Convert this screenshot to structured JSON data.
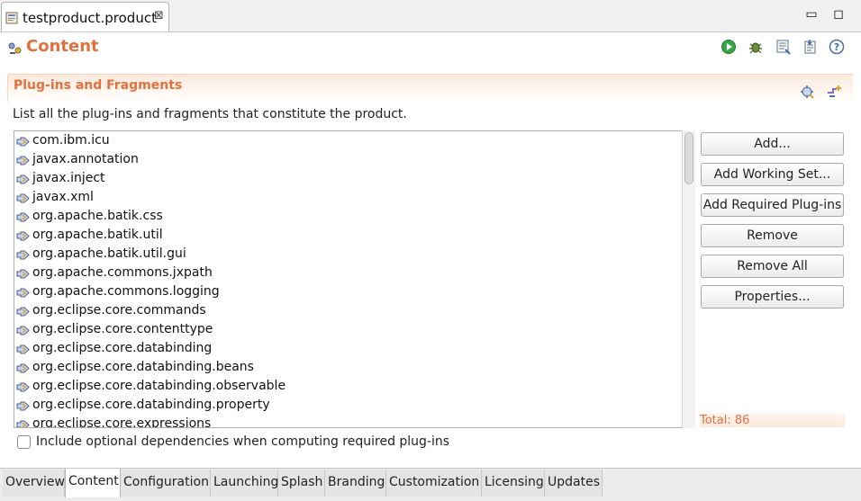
{
  "editor": {
    "tab_title": "testproduct.product",
    "close_glyph": "⊠",
    "minimize_glyph": "▭",
    "maximize_glyph": "◻"
  },
  "header": {
    "title": "Content"
  },
  "section": {
    "title": "Plug-ins and Fragments",
    "description": "List all the plug-ins and fragments that constitute the product."
  },
  "plugins": [
    "com.ibm.icu",
    "javax.annotation",
    "javax.inject",
    "javax.xml",
    "org.apache.batik.css",
    "org.apache.batik.util",
    "org.apache.batik.util.gui",
    "org.apache.commons.jxpath",
    "org.apache.commons.logging",
    "org.eclipse.core.commands",
    "org.eclipse.core.contenttype",
    "org.eclipse.core.databinding",
    "org.eclipse.core.databinding.beans",
    "org.eclipse.core.databinding.observable",
    "org.eclipse.core.databinding.property",
    "org.eclipse.core.expressions"
  ],
  "buttons": {
    "add": "Add...",
    "add_working_set": "Add Working Set...",
    "add_required": "Add Required Plug-ins",
    "remove": "Remove",
    "remove_all": "Remove All",
    "properties": "Properties..."
  },
  "total_label": "Total: 86",
  "optional_deps": {
    "label": "Include optional dependencies when computing required plug-ins",
    "checked": false
  },
  "page_tabs": [
    {
      "label": "Overview",
      "active": false
    },
    {
      "label": "Content",
      "active": true
    },
    {
      "label": "Configuration",
      "active": false
    },
    {
      "label": "Launching",
      "active": false
    },
    {
      "label": "Splash",
      "active": false
    },
    {
      "label": "Branding",
      "active": false
    },
    {
      "label": "Customization",
      "active": false
    },
    {
      "label": "Licensing",
      "active": false
    },
    {
      "label": "Updates",
      "active": false
    }
  ],
  "colors": {
    "accent": "#e2713b",
    "section_gradient": "#fbe9dc"
  }
}
